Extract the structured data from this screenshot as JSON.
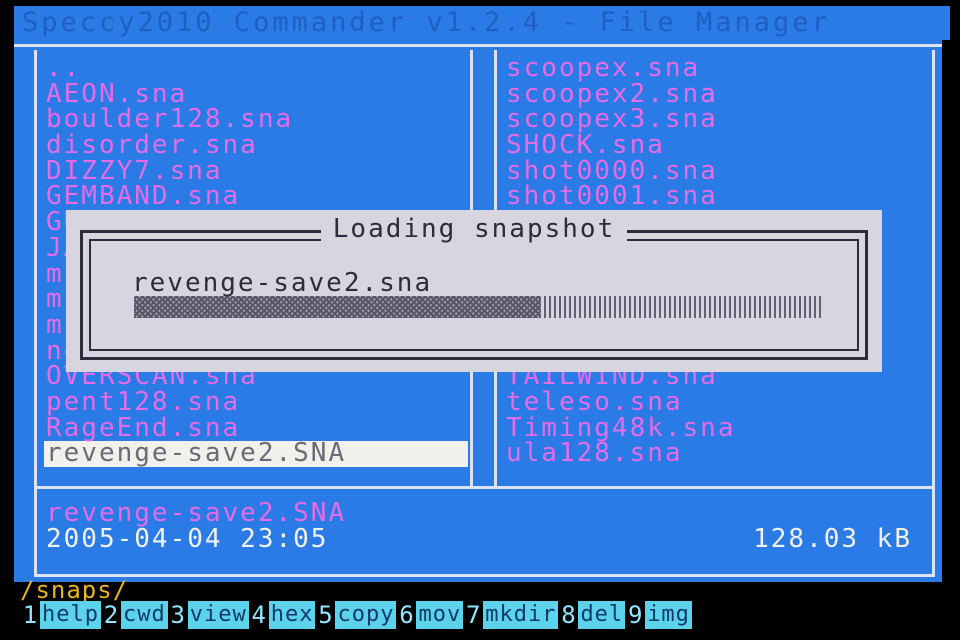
{
  "title": "Speccy2010 Commander v1.2.4 - File Manager",
  "left_panel": {
    "files": [
      "..",
      "AEON.sna",
      "boulder128.sna",
      "disorder.sna",
      "DIZZY7.sna",
      "GEMBAND.sna",
      "GU",
      "JA",
      "mu",
      "mu",
      "mu",
      "ne",
      "OVERSCAN.sna",
      "pent128.sna",
      "RageEnd.sna",
      "revenge-save2.SNA"
    ],
    "selected_index": 15
  },
  "right_panel": {
    "files": [
      "scoopex.sna",
      "scoopex2.sna",
      "scoopex3.sna",
      "SHOCK.sna",
      "shot0000.sna",
      "shot0001.sna",
      "",
      "",
      "",
      "",
      "",
      "",
      "TAILWIND.sna",
      "teleso.sna",
      "Timing48k.sna",
      "ula128.sna"
    ]
  },
  "info": {
    "filename": "revenge-save2.SNA",
    "date": "2005-04-04 23:05",
    "size": "128.03 kB"
  },
  "dialog": {
    "title": "Loading snapshot",
    "filename": "revenge-save2.sna",
    "progress": 0.59
  },
  "path": "/snaps/",
  "function_keys": [
    {
      "num": "1",
      "label": "help"
    },
    {
      "num": "2",
      "label": "cwd"
    },
    {
      "num": "3",
      "label": "view"
    },
    {
      "num": "4",
      "label": "hex"
    },
    {
      "num": "5",
      "label": "copy"
    },
    {
      "num": "6",
      "label": "mov"
    },
    {
      "num": "7",
      "label": "mkdir"
    },
    {
      "num": "8",
      "label": "del"
    },
    {
      "num": "9",
      "label": "img"
    }
  ],
  "colors": {
    "background": "#2a7be6",
    "file_text": "#e46ce6",
    "selection": "#f1f1ec",
    "dialog_bg": "#d7d5df",
    "path_text": "#e8b424",
    "fkey_bg": "#5cd3ea"
  }
}
